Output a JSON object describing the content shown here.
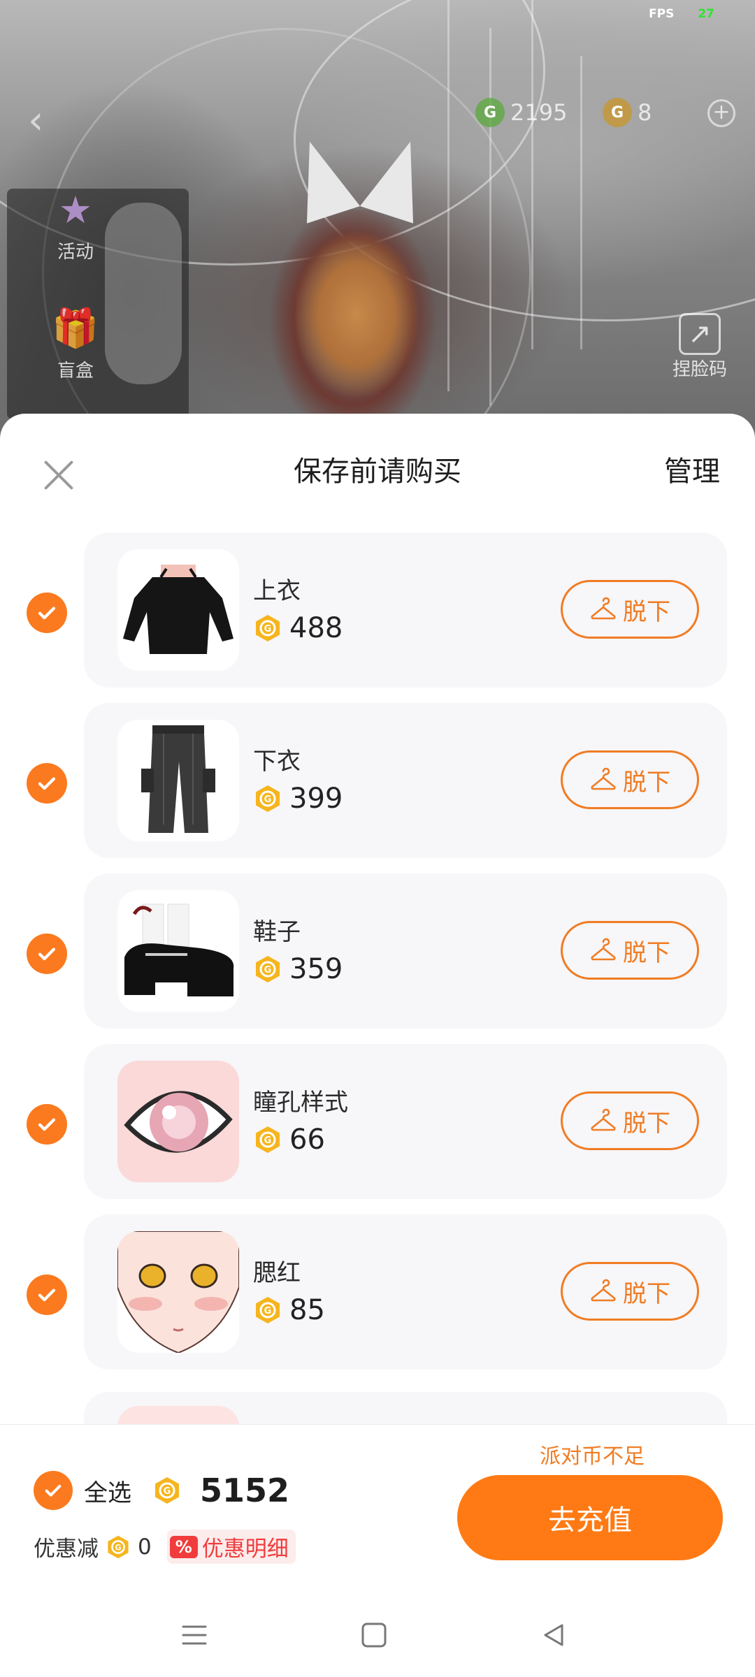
{
  "status": {
    "fps_label": "FPS",
    "fps_value": "27"
  },
  "scene": {
    "currency_g": "2195",
    "currency_b": "8",
    "side_left": [
      {
        "label": "活动",
        "icon": "star-badge-icon"
      },
      {
        "label": "盲盒",
        "icon": "gift-box-icon"
      }
    ],
    "side_right": [
      {
        "label": "捏脸码",
        "icon": "share-code-icon"
      }
    ]
  },
  "sheet": {
    "title": "保存前请购买",
    "manage_label": "管理",
    "items": [
      {
        "name": "上衣",
        "price": "488",
        "action": "脱下",
        "thumb": "black-top",
        "checked": true
      },
      {
        "name": "下衣",
        "price": "399",
        "action": "脱下",
        "thumb": "cargo-pants",
        "checked": true
      },
      {
        "name": "鞋子",
        "price": "359",
        "action": "脱下",
        "thumb": "platform-shoes",
        "checked": true
      },
      {
        "name": "瞳孔样式",
        "price": "66",
        "action": "脱下",
        "thumb": "eye-pupil",
        "checked": true
      },
      {
        "name": "腮红",
        "price": "85",
        "action": "脱下",
        "thumb": "face-blush",
        "checked": true
      }
    ]
  },
  "footer": {
    "select_all_label": "全选",
    "total": "5152",
    "discount_label": "优惠减",
    "discount_value": "0",
    "promo_badge": "%",
    "promo_label": "优惠明细",
    "insufficient_text": "派对币不足",
    "recharge_label": "去充值"
  },
  "colors": {
    "accent": "#ff7a14",
    "outline": "#f07c23",
    "coin": "#f6b51e",
    "card": "#f7f6f9",
    "promo": "#f03c3c"
  }
}
